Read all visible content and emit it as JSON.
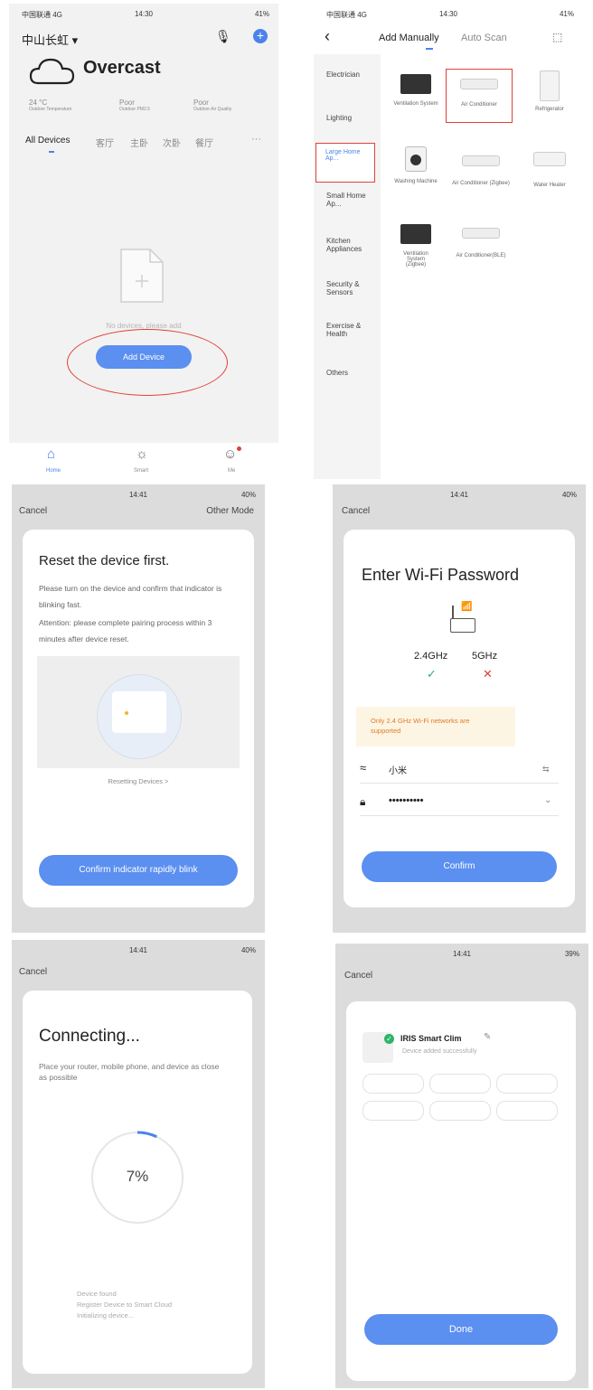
{
  "status": {
    "p1": {
      "carrier": "中国联通 4G",
      "time": "14:30",
      "battery": "41%"
    },
    "p2": {
      "carrier": "中国联通 4G",
      "time": "14:30",
      "battery": "41%"
    },
    "p3": {
      "carrier": "",
      "time": "14:41",
      "battery": "40%"
    },
    "p4": {
      "carrier": "",
      "time": "14:41",
      "battery": "40%"
    },
    "p5": {
      "carrier": "",
      "time": "14:41",
      "battery": "40%"
    },
    "p6": {
      "carrier": "",
      "time": "14:41",
      "battery": "39%"
    }
  },
  "home": {
    "location": "中山长虹 ▾",
    "weather": "Overcast",
    "stats": [
      {
        "value": "24 °C",
        "label": "Outdoor Temperature"
      },
      {
        "value": "Poor",
        "label": "Outdoor PM2.5"
      },
      {
        "value": "Poor",
        "label": "Outdoor Air Quality"
      }
    ],
    "tabs": [
      "All Devices",
      "客厅",
      "主卧",
      "次卧",
      "餐厅",
      "···"
    ],
    "empty_text": "No devices, please add",
    "add_button": "Add Device",
    "nav": [
      "Home",
      "Smart",
      "Me"
    ]
  },
  "add": {
    "back": "‹",
    "tab_manual": "Add Manually",
    "tab_scan": "Auto Scan",
    "categories": [
      "Electrician",
      "Lighting",
      "Large Home Ap...",
      "Small Home Ap...",
      "Kitchen Appliances",
      "Security & Sensors",
      "Exercise & Health",
      "Others"
    ],
    "devices": [
      "Ventilation System",
      "Air Conditioner",
      "Refrigerator",
      "Washing Machine",
      "Air Conditioner (Zigbee)",
      "Water Heater",
      "Ventilation System (Zigbee)",
      "Air Conditioner(BLE)"
    ]
  },
  "reset": {
    "cancel": "Cancel",
    "other": "Other Mode",
    "title": "Reset the device first.",
    "body": "Please turn on the device and confirm that indicator is blinking fast.",
    "attention": "Attention: please complete pairing process within 3 minutes after device reset.",
    "link": "Resetting Devices >",
    "button": "Confirm indicator rapidly blink"
  },
  "wifi": {
    "cancel": "Cancel",
    "title": "Enter Wi-Fi Password",
    "band_24": "2.4GHz",
    "band_5": "5GHz",
    "notice": "Only 2.4 GHz Wi-Fi networks are supported",
    "ssid": "小米",
    "password": "••••••••••",
    "button": "Confirm"
  },
  "connecting": {
    "cancel": "Cancel",
    "title": "Connecting...",
    "body": "Place your router, mobile phone, and device as close as possible",
    "percent": "7%",
    "progress": 0.07,
    "steps": [
      "Device found",
      "Register Device to Smart Cloud",
      "Initializing device..."
    ]
  },
  "done": {
    "cancel": "Cancel",
    "device_name": "IRIS Smart Clim",
    "status": "Device added successfully",
    "button": "Done"
  },
  "colors": {
    "accent": "#5b8ff0",
    "highlight": "#e0413a",
    "green": "#2db36a",
    "panel_gray": "#dcdcdc"
  }
}
